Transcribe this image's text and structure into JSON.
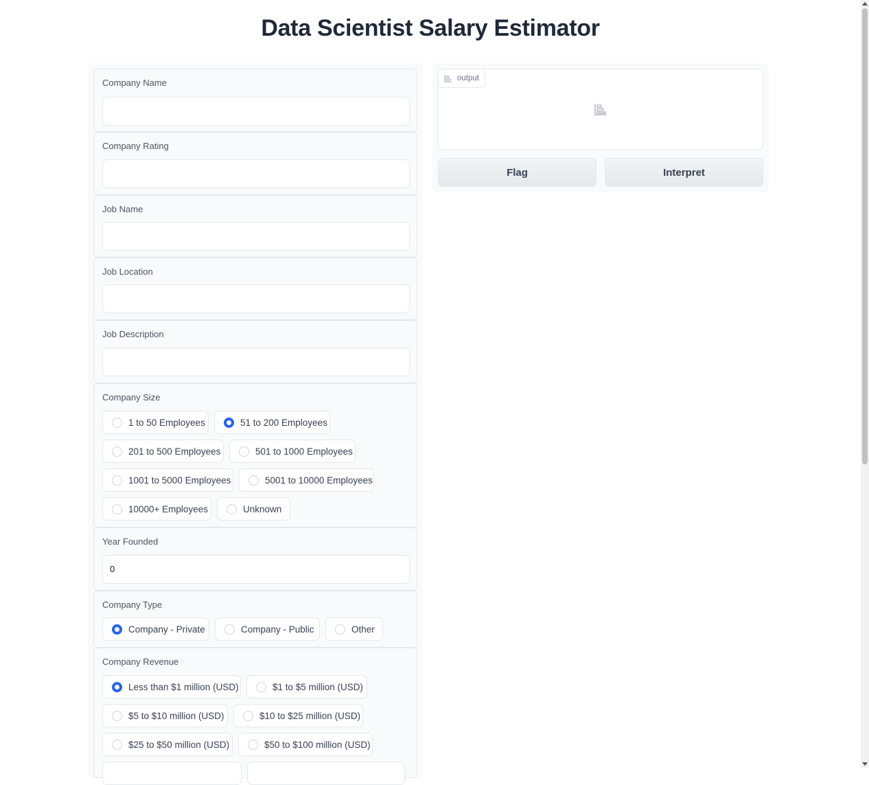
{
  "page": {
    "title": "Data Scientist Salary Estimator"
  },
  "inputs": {
    "company_name": {
      "label": "Company Name",
      "value": ""
    },
    "company_rating": {
      "label": "Company Rating",
      "value": ""
    },
    "job_name": {
      "label": "Job Name",
      "value": ""
    },
    "job_location": {
      "label": "Job Location",
      "value": ""
    },
    "job_description": {
      "label": "Job Description",
      "value": ""
    },
    "company_size": {
      "label": "Company Size",
      "selected": "51 to 200 Employees",
      "options": [
        "1 to 50 Employees",
        "51 to 200 Employees",
        "201 to 500 Employees",
        "501 to 1000 Employees",
        "1001 to 5000 Employees",
        "5001 to 10000 Employees",
        "10000+ Employees",
        "Unknown"
      ]
    },
    "year_founded": {
      "label": "Year Founded",
      "value": "0"
    },
    "company_type": {
      "label": "Company Type",
      "selected": "Company - Private",
      "options": [
        "Company - Private",
        "Company - Public",
        "Other"
      ]
    },
    "company_revenue": {
      "label": "Company Revenue",
      "selected": "Less than $1 million (USD)",
      "options": [
        "Less than $1 million (USD)",
        "$1 to $5 million (USD)",
        "$5 to $10 million (USD)",
        "$10 to $25 million (USD)",
        "$25 to $50 million (USD)",
        "$50 to $100 million (USD)"
      ]
    }
  },
  "output": {
    "label": "output",
    "icon": "chart-icon"
  },
  "buttons": {
    "flag": "Flag",
    "interpret": "Interpret"
  },
  "colors": {
    "accent": "#2563eb",
    "panel": "#f9fafb",
    "border": "#e5e7eb"
  }
}
